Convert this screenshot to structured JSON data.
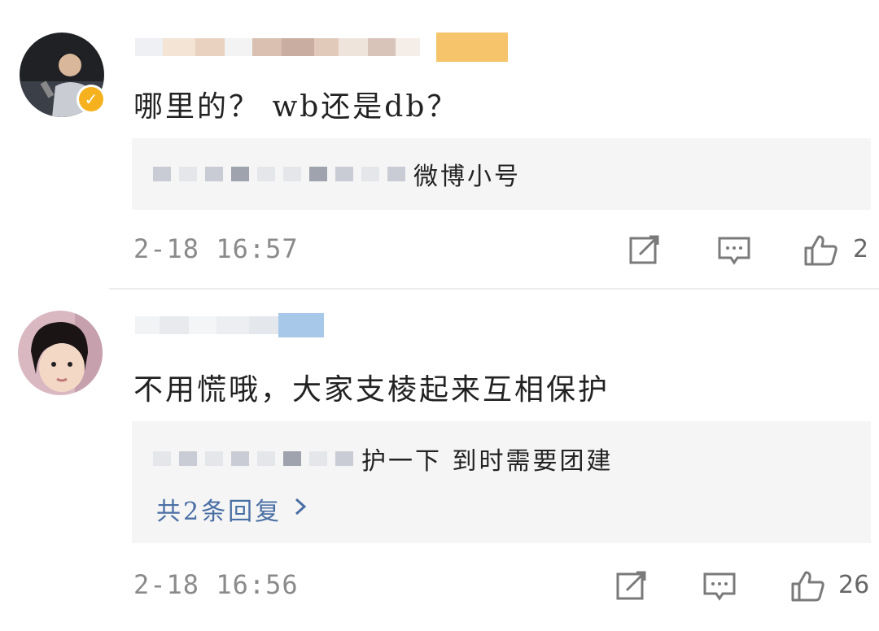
{
  "comments": [
    {
      "username_visible": "",
      "verified": true,
      "text": "哪里的？ wb还是db？",
      "reply": {
        "text": "微博小号"
      },
      "time": "2-18 16:57",
      "likes": "2",
      "icons": {
        "share": "share-icon",
        "reply": "comment-icon",
        "like": "thumbs-up-icon"
      }
    },
    {
      "username_visible": "",
      "verified": false,
      "text": "不用慌哦，大家支棱起来互相保护",
      "reply": {
        "text": "护一下 到时需要团建",
        "more": "共2条回复"
      },
      "time": "2-18 16:56",
      "likes": "26",
      "icons": {
        "share": "share-icon",
        "reply": "comment-icon",
        "like": "thumbs-up-icon"
      }
    }
  ],
  "colors": {
    "badge": "#f5b21e",
    "link": "#4a6fa5",
    "reply_bg": "#f5f5f5",
    "meta": "#8a8a8a"
  }
}
